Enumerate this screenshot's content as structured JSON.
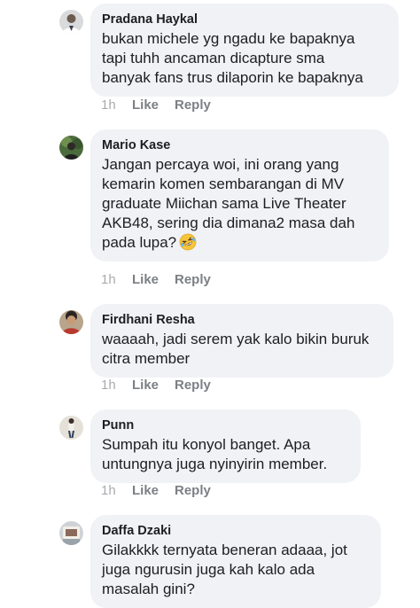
{
  "comments": [
    {
      "author": "Pradana Haykal",
      "text": "bukan michele yg ngadu ke bapaknya\ntapi tuhh ancaman dicapture sma\nbanyak fans trus dilaporin ke bapaknya",
      "time": "1h",
      "like_label": "Like",
      "reply_label": "Reply",
      "avatar": "user-avatar"
    },
    {
      "author": "Mario Kase",
      "text": "Jangan percaya woi, ini orang yang\nkemarin komen sembarangan di MV\ngraduate Miichan sama Live Theater\nAKB48, sering dia dimana2 masa dah\npada lupa?",
      "emoji": "rolling-on-floor-laughing-emoji",
      "time": "1h",
      "like_label": "Like",
      "reply_label": "Reply",
      "avatar": "user-avatar"
    },
    {
      "author": "Firdhani Resha",
      "text": "waaaah, jadi serem yak kalo bikin buruk\ncitra member",
      "time": "1h",
      "like_label": "Like",
      "reply_label": "Reply",
      "avatar": "user-avatar"
    },
    {
      "author": "Punn",
      "text": "Sumpah itu konyol banget. Apa\nuntungnya juga nyinyirin member.",
      "time": "1h",
      "like_label": "Like",
      "reply_label": "Reply",
      "avatar": "user-avatar"
    },
    {
      "author": "Daffa Dzaki",
      "text": "Gilakkkk ternyata beneran adaaa, jot\njuga ngurusin juga kah kalo ada\nmasalah gini?",
      "avatar": "user-avatar"
    }
  ],
  "colors": {
    "bubble": "#f0f2f5",
    "text": "#1c1e21",
    "meta": "#8a8d91"
  }
}
